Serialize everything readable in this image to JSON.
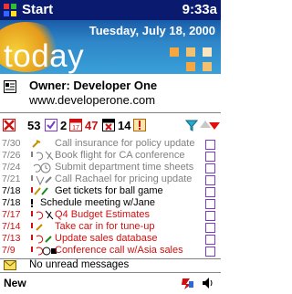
{
  "titlebar": {
    "start_label": "Start",
    "time": "9:33a"
  },
  "banner": {
    "date": "Tuesday, July 18, 2000",
    "word": "today"
  },
  "owner": {
    "name": "Owner: Developer One",
    "website": "www.developerone.com"
  },
  "stats": {
    "overdue": "53",
    "completed": "2",
    "calendar": "47",
    "flagged": "14"
  },
  "tasks": [
    {
      "date": "7/30",
      "text": "Call insurance for policy update",
      "color": "#808080"
    },
    {
      "date": "7/26",
      "text": "Book flight for CA conference",
      "color": "#808080"
    },
    {
      "date": "7/24",
      "text": "Submit department time sheets",
      "color": "#808080"
    },
    {
      "date": "7/21",
      "text": "Call Rachael for pricing update",
      "color": "#808080"
    },
    {
      "date": "7/18",
      "text": "Get tickets for ball game",
      "color": "#000000"
    },
    {
      "date": "7/18",
      "text": "Schedule meeting w/Jane",
      "color": "#000000"
    },
    {
      "date": "7/17",
      "text": "Q4 Budget Estimates",
      "color": "#d01010"
    },
    {
      "date": "7/14",
      "text": "Take car in for tune-up",
      "color": "#d01010"
    },
    {
      "date": "7/13",
      "text": "Update sales database",
      "color": "#d01010"
    },
    {
      "date": "7/9",
      "text": "Conference call w/Asia sales",
      "color": "#d01010"
    }
  ],
  "messages": {
    "text": "No unread messages"
  },
  "bottombar": {
    "new_label": "New"
  },
  "colors": {
    "titlebar": "#0a1a6e",
    "overdue": "#d01010",
    "checkbox": "#7a3cc8"
  }
}
